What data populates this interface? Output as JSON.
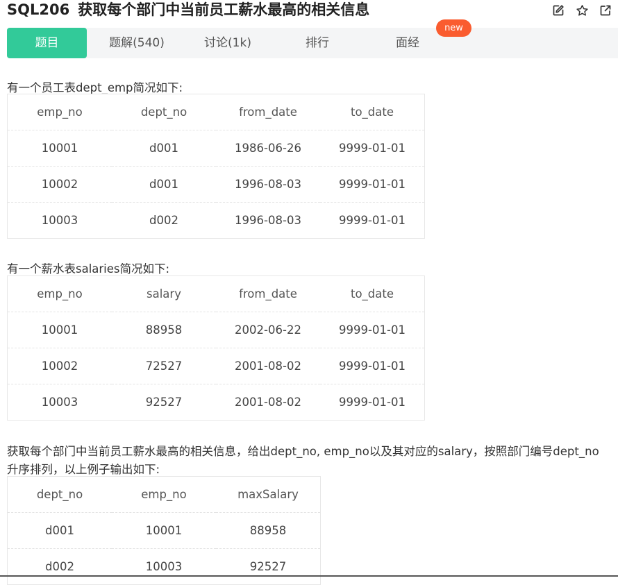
{
  "problem": {
    "number": "SQL206",
    "title": "获取每个部门中当前员工薪水最高的相关信息"
  },
  "actions": [
    {
      "name": "edit-icon"
    },
    {
      "name": "star-icon"
    },
    {
      "name": "external-link-icon"
    }
  ],
  "tabs": [
    {
      "label": "题目",
      "active": true
    },
    {
      "label": "题解(540)"
    },
    {
      "label": "讨论(1k)"
    },
    {
      "label": "排行"
    },
    {
      "label": "面经"
    }
  ],
  "badge": "new",
  "colors": {
    "accent": "#32ca99",
    "badge": "#fa5c2f"
  },
  "sections": {
    "dept_emp_intro": "有一个员工表dept_emp简况如下:",
    "salaries_intro": "有一个薪水表salaries简况如下:",
    "task_line1": "获取每个部门中当前员工薪水最高的相关信息，给出dept_no, emp_no以及其对应的salary，按照部门编号dept_no",
    "task_line2": "升序排列，以上例子输出如下:"
  },
  "dept_emp": {
    "headers": [
      "emp_no",
      "dept_no",
      "from_date",
      "to_date"
    ],
    "rows": [
      [
        "10001",
        "d001",
        "1986-06-26",
        "9999-01-01"
      ],
      [
        "10002",
        "d001",
        "1996-08-03",
        "9999-01-01"
      ],
      [
        "10003",
        "d002",
        "1996-08-03",
        "9999-01-01"
      ]
    ]
  },
  "salaries": {
    "headers": [
      "emp_no",
      "salary",
      "from_date",
      "to_date"
    ],
    "rows": [
      [
        "10001",
        "88958",
        "2002-06-22",
        "9999-01-01"
      ],
      [
        "10002",
        "72527",
        "2001-08-02",
        "9999-01-01"
      ],
      [
        "10003",
        "92527",
        "2001-08-02",
        "9999-01-01"
      ]
    ]
  },
  "result": {
    "headers": [
      "dept_no",
      "emp_no",
      "maxSalary"
    ],
    "rows": [
      [
        "d001",
        "10001",
        "88958"
      ],
      [
        "d002",
        "10003",
        "92527"
      ]
    ]
  }
}
